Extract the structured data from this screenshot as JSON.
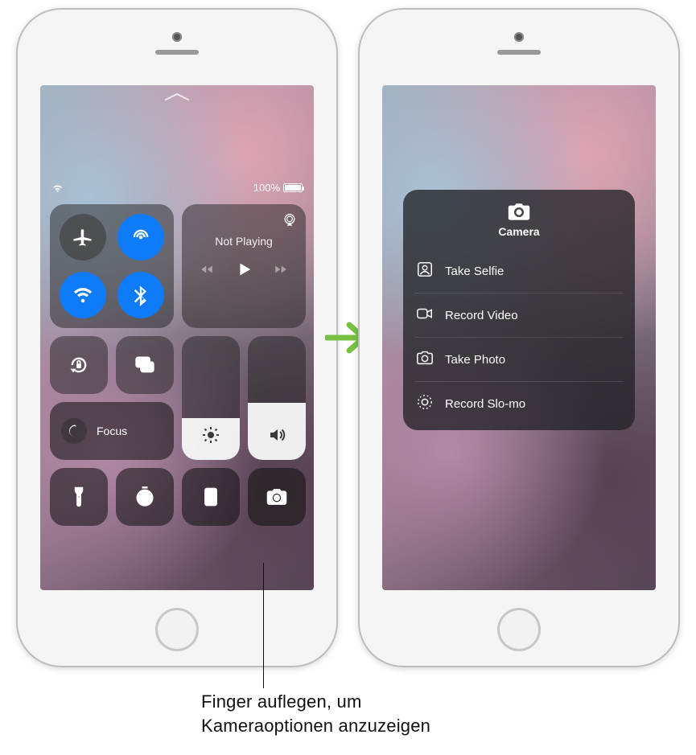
{
  "status": {
    "battery_text": "100%"
  },
  "control_center": {
    "now_playing_label": "Not Playing",
    "focus_label": "Focus"
  },
  "camera_popup": {
    "title": "Camera",
    "actions": [
      {
        "label": "Take Selfie"
      },
      {
        "label": "Record Video"
      },
      {
        "label": "Take Photo"
      },
      {
        "label": "Record Slo-mo"
      }
    ]
  },
  "callout": {
    "line1": "Finger auflegen, um",
    "line2": "Kameraoptionen anzuzeigen"
  }
}
